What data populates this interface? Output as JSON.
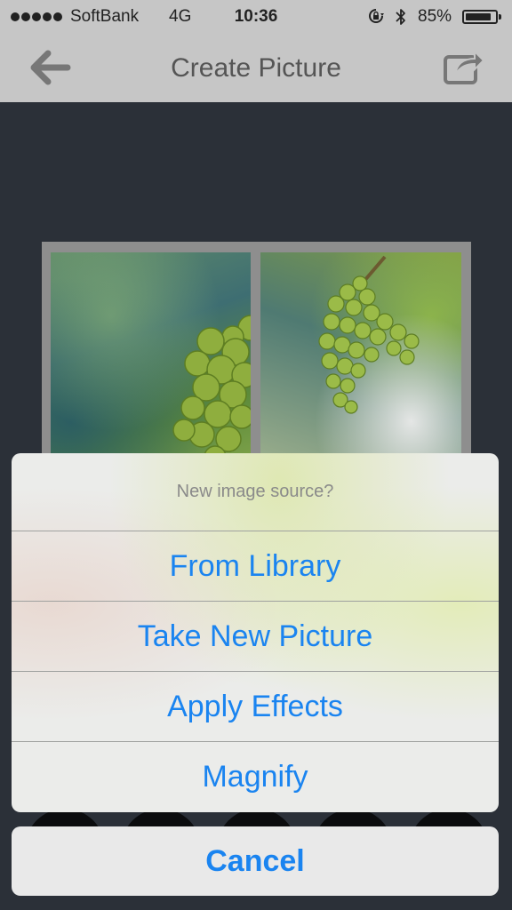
{
  "status_bar": {
    "carrier": "SoftBank",
    "network": "4G",
    "time": "10:36",
    "battery_percent": "85%",
    "battery_level": 0.85,
    "signal_bars": 5
  },
  "nav": {
    "title": "Create Picture",
    "back_icon": "arrow-left-icon",
    "share_icon": "share-icon"
  },
  "action_sheet": {
    "title": "New image source?",
    "options": [
      {
        "label": "From Library"
      },
      {
        "label": "Take New Picture"
      },
      {
        "label": "Apply Effects"
      },
      {
        "label": "Magnify"
      }
    ],
    "cancel_label": "Cancel"
  },
  "colors": {
    "accent": "#1a84f0",
    "nav_bar": "#c6c6c6",
    "background": "#2b3038"
  }
}
